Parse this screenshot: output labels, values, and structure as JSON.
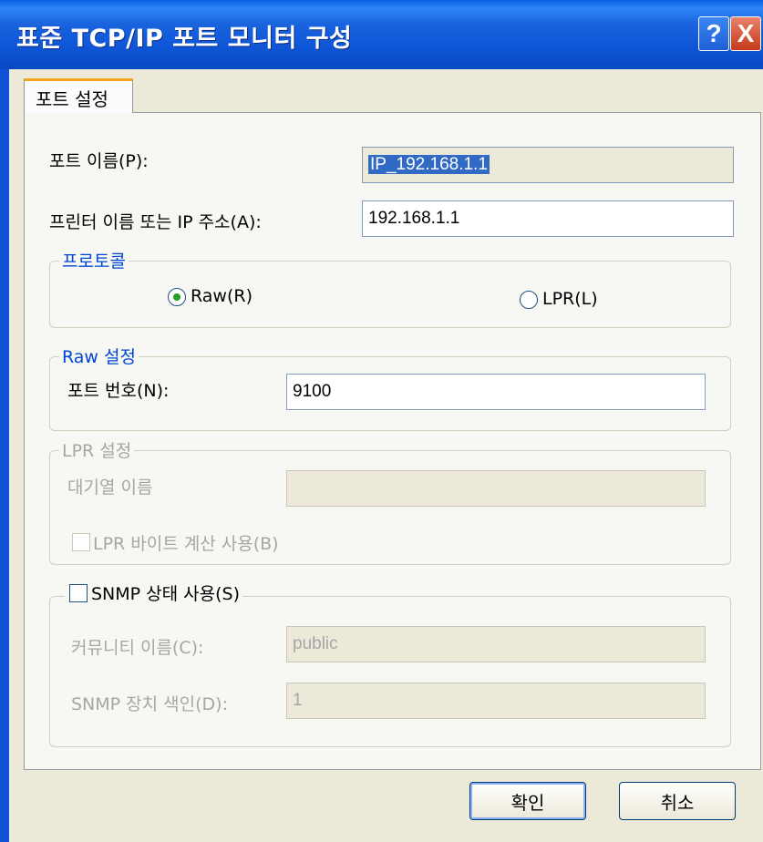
{
  "window": {
    "title": "표준 TCP/IP 포트 모니터 구성",
    "help_symbol": "?",
    "close_symbol": "X"
  },
  "tabs": [
    {
      "label": "포트 설정"
    }
  ],
  "port_name": {
    "label": "포트 이름(P):",
    "value": "IP_192.168.1.1"
  },
  "printer_address": {
    "label": "프린터 이름 또는 IP 주소(A):",
    "value": "192.168.1.1"
  },
  "protocol": {
    "legend": "프로토콜",
    "raw": {
      "label": "Raw(R)",
      "selected": true
    },
    "lpr": {
      "label": "LPR(L)",
      "selected": false
    }
  },
  "raw_settings": {
    "legend": "Raw 설정",
    "port_number": {
      "label": "포트 번호(N):",
      "value": "9100"
    }
  },
  "lpr_settings": {
    "legend": "LPR 설정",
    "queue_name": {
      "label": "대기열 이름",
      "value": ""
    },
    "byte_counting": {
      "label": "LPR 바이트 계산 사용(B)",
      "checked": false
    }
  },
  "snmp": {
    "checkbox_label": "SNMP 상태 사용(S)",
    "checked": false,
    "community": {
      "label": "커뮤니티 이름(C):",
      "value": "public"
    },
    "device_index": {
      "label": "SNMP 장치 색인(D):",
      "value": "1"
    }
  },
  "buttons": {
    "ok": "확인",
    "cancel": "취소"
  },
  "colors": {
    "titlebar": "#0a5fe0",
    "group_legend": "#0046d5",
    "disabled_text": "#a6a6a6"
  }
}
